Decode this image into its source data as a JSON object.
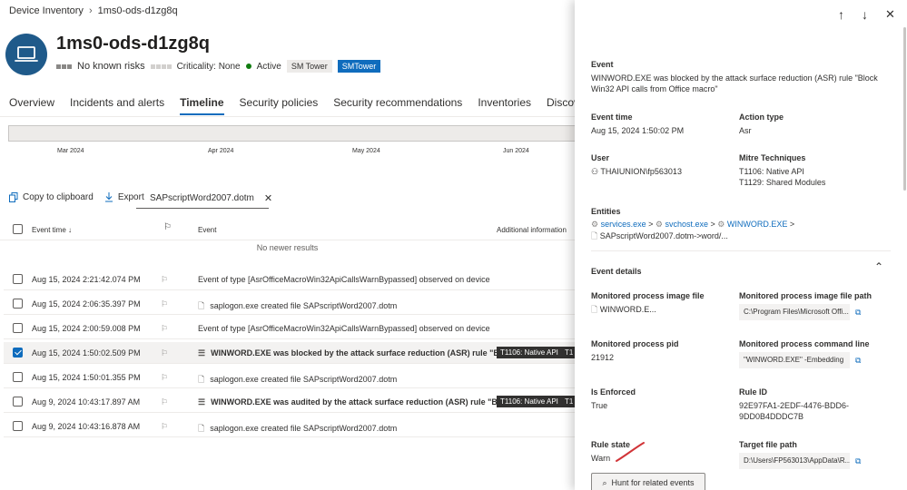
{
  "breadcrumb": {
    "root": "Device Inventory",
    "current": "1ms0-ods-d1zg8q"
  },
  "device": {
    "name": "1ms0-ods-d1zg8q",
    "risk": "No known risks",
    "criticality": "Criticality: None",
    "status": "Active",
    "tags": [
      "SM Tower",
      "SMTower"
    ]
  },
  "tabs": [
    "Overview",
    "Incidents and alerts",
    "Timeline",
    "Security policies",
    "Security recommendations",
    "Inventories",
    "Discovered vulnerabilities"
  ],
  "active_tab": "Timeline",
  "timeline_months": [
    "Mar 2024",
    "Apr 2024",
    "May 2024",
    "Jun 2024"
  ],
  "toolbar": {
    "copy": "Copy to clipboard",
    "export": "Export",
    "filter": "SAPscriptWord2007.dotm"
  },
  "table": {
    "headers": {
      "time": "Event time ↓",
      "event": "Event",
      "info": "Additional information"
    },
    "no_newer": "No newer results",
    "rows": [
      {
        "time": "Aug 15, 2024 2:21:42.074 PM",
        "event": "Event of type [AsrOfficeMacroWin32ApiCallsWarnBypassed] observed on device",
        "bold": false,
        "icon": "none",
        "selected": false,
        "pills": []
      },
      {
        "time": "Aug 15, 2024 2:06:35.397 PM",
        "event": "saplogon.exe created file SAPscriptWord2007.dotm",
        "bold": false,
        "icon": "file-icon",
        "selected": false,
        "pills": []
      },
      {
        "time": "Aug 15, 2024 2:00:59.008 PM",
        "event": "Event of type [AsrOfficeMacroWin32ApiCallsWarnBypassed] observed on device",
        "bold": false,
        "icon": "none",
        "selected": false,
        "pills": []
      },
      {
        "time": "Aug 15, 2024 1:50:02.509 PM",
        "event": "WINWORD.EXE was blocked by the attack surface reduction (ASR) rule \"Bl...",
        "bold": true,
        "icon": "asr-icon",
        "selected": true,
        "pills": [
          "T1106: Native API",
          "T1"
        ]
      },
      {
        "time": "Aug 15, 2024 1:50:01.355 PM",
        "event": "saplogon.exe created file SAPscriptWord2007.dotm",
        "bold": false,
        "icon": "file-icon",
        "selected": false,
        "pills": []
      },
      {
        "time": "Aug 9, 2024 10:43:17.897 AM",
        "event": "WINWORD.EXE was audited by the attack surface reduction (ASR) rule \"Bl...",
        "bold": true,
        "icon": "asr-icon",
        "selected": false,
        "pills": [
          "T1106: Native API",
          "T1"
        ]
      },
      {
        "time": "Aug 9, 2024 10:43:16.878 AM",
        "event": "saplogon.exe created file SAPscriptWord2007.dotm",
        "bold": false,
        "icon": "file-icon",
        "selected": false,
        "pills": []
      }
    ]
  },
  "panel": {
    "event_label": "Event",
    "event_text_1": "WINWORD.EXE was blocked by the attack surface reduction (ASR) rule \"Block",
    "event_text_2": "Win32 API calls from Office macro\"",
    "event_time_label": "Event time",
    "event_time": "Aug 15, 2024 1:50:02 PM",
    "action_type_label": "Action type",
    "action_type": "Asr",
    "user_label": "User",
    "user": "THAIUNION\\fp563013",
    "mitre_label": "Mitre Techniques",
    "mitre_1": "T1106: Native API",
    "mitre_2": "T1129: Shared Modules",
    "entities_label": "Entities",
    "entity_1": "services.exe",
    "entity_2": "svchost.exe",
    "entity_3": "WINWORD.EXE",
    "entity_4": "SAPscriptWord2007.dotm->word/...",
    "details_label": "Event details",
    "mpi_label": "Monitored process image file",
    "mpi": "WINWORD.E...",
    "mpip_label": "Monitored process image file path",
    "mpip": "C:\\Program Files\\Microsoft Offi...",
    "pid_label": "Monitored process pid",
    "pid": "21912",
    "cmd_label": "Monitored process command line",
    "cmd": "\"WINWORD.EXE\" -Embedding",
    "enforced_label": "Is Enforced",
    "enforced": "True",
    "rule_id_label": "Rule ID",
    "rule_id_1": "92E97FA1-2EDF-4476-BDD6-",
    "rule_id_2": "9DD0B4DDDC7B",
    "rule_state_label": "Rule state",
    "rule_state": "Warn",
    "target_label": "Target file path",
    "target": "D:\\Users\\FP563013\\AppData\\R...",
    "hunt": "Hunt for related events"
  },
  "colors": {
    "accent": "#0f6cbd",
    "avatar": "#1f5a8a",
    "active": "#107c10",
    "pill": "#323130",
    "annotation": "#d13438"
  }
}
